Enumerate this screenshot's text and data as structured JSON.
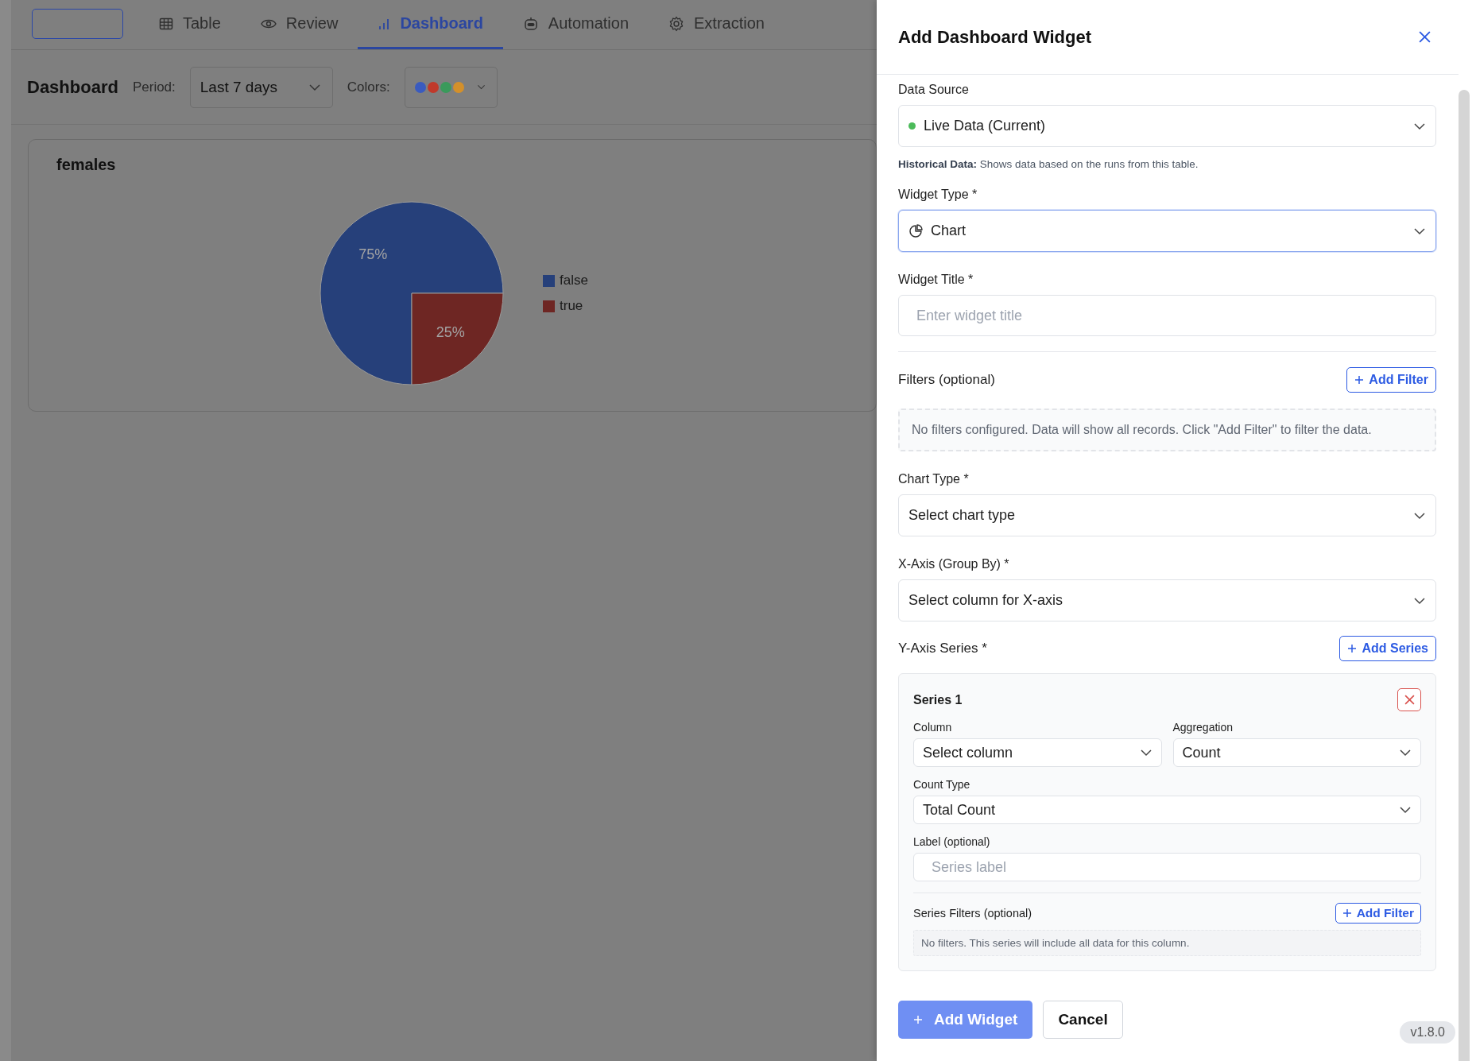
{
  "nav": {
    "tabs": [
      {
        "label": "Table",
        "selected": false
      },
      {
        "label": "Review",
        "selected": false
      },
      {
        "label": "Dashboard",
        "selected": true
      },
      {
        "label": "Automation",
        "selected": false
      },
      {
        "label": "Extraction",
        "selected": false
      }
    ]
  },
  "toolbar": {
    "title": "Dashboard",
    "period_label": "Period:",
    "period_value": "Last 7 days",
    "colors_label": "Colors:",
    "palette": [
      {
        "color": "#3a5bbf"
      },
      {
        "color": "#c0392b"
      },
      {
        "color": "#3a9a5b"
      },
      {
        "color": "#d4902a"
      }
    ]
  },
  "widgets": [
    {
      "title": "females",
      "chart_data": {
        "type": "pie",
        "categories": [
          "false",
          "true"
        ],
        "values": [
          75,
          25
        ],
        "colors": [
          "#26407a",
          "#6e2623"
        ],
        "value_labels": [
          "75%",
          "25%"
        ],
        "legend": "right"
      }
    }
  ],
  "drawer": {
    "title": "Add Dashboard Widget",
    "data_source": {
      "label": "Data Source",
      "value": "Live Data (Current)",
      "color": "#4cbb5a",
      "focused": false
    },
    "hint": "**Historical Data:** Shows data based on the runs from this table.",
    "widget_type": {
      "label": "Widget Type *",
      "value": "Chart",
      "focused": true
    },
    "widget_title": {
      "label": "Widget Title *",
      "placeholder": "Enter widget title"
    },
    "filters": {
      "label": "Filters (optional)",
      "button": "Add Filter",
      "empty": "No filters configured. Data will show all records. Click \"Add Filter\" to filter the data."
    },
    "chart_type": {
      "label": "Chart Type *",
      "value": "Select chart type",
      "focused": false
    },
    "x_axis": {
      "label": "X-Axis (Group By) *",
      "value": "Select column for X-axis",
      "focused": false
    },
    "y_axis": {
      "label": "Y-Axis Series *",
      "button": "Add Series"
    },
    "series": [
      {
        "title": "Series 1",
        "column": {
          "label": "Column",
          "value": "Select column"
        },
        "aggregation": {
          "label": "Aggregation",
          "value": "Count"
        },
        "count_type": {
          "label": "Count Type",
          "value": "Total Count"
        },
        "label_field": {
          "label": "Label (optional)",
          "placeholder": "Series label"
        },
        "filters_label": "Series Filters (optional)",
        "filters_button": "Add Filter",
        "filters_empty": "No filters. This series will include all data for this column."
      }
    ],
    "actions": [
      {
        "label": "Add Widget",
        "kind": "primary"
      },
      {
        "label": "Cancel",
        "kind": "secondary"
      }
    ],
    "version": "v1.8.0"
  }
}
